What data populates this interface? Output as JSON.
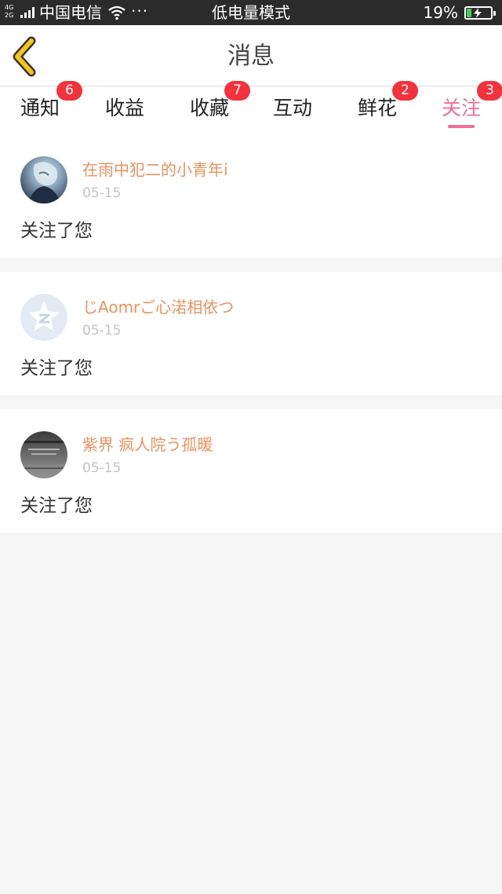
{
  "status_bar": {
    "network_top": "4G",
    "network_bottom": "2G",
    "carrier": "中国电信",
    "dots": "···",
    "mode": "低电量模式",
    "battery_percent": "19%",
    "battery_level": 0.19,
    "battery_color": "#43d15a"
  },
  "header": {
    "back_icon": "chevron-left-icon",
    "back_color": "#f5c518",
    "title": "消息"
  },
  "tabs": [
    {
      "label": "通知",
      "badge": "6",
      "active": false
    },
    {
      "label": "收益",
      "badge": "",
      "active": false
    },
    {
      "label": "收藏",
      "badge": "7",
      "active": false
    },
    {
      "label": "互动",
      "badge": "",
      "active": false
    },
    {
      "label": "鲜花",
      "badge": "2",
      "active": false
    },
    {
      "label": "关注",
      "badge": "3",
      "active": true
    }
  ],
  "colors": {
    "accent": "#ee6f98",
    "badge": "#f2323c",
    "username": "#e8935f"
  },
  "messages": [
    {
      "username": "在雨中犯二的小青年i",
      "date": "05-15",
      "text": "关注了您",
      "avatar": "anime-avatar"
    },
    {
      "username": "じAomrご心渃相依つ",
      "date": "05-15",
      "text": "关注了您",
      "avatar": "qzone-default-avatar"
    },
    {
      "username": "紫界 疯人院う孤暖",
      "date": "05-15",
      "text": "关注了您",
      "avatar": "dark-photo-avatar"
    }
  ]
}
